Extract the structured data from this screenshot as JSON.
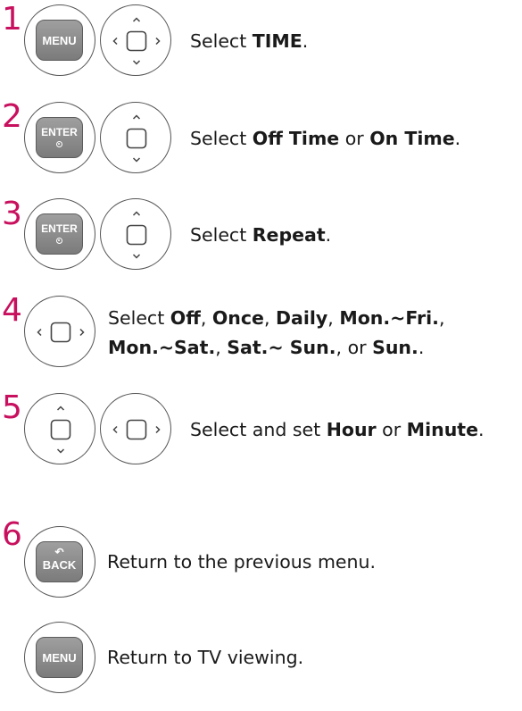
{
  "steps": [
    {
      "number": "1",
      "buttons": [
        "MENU",
        "up-down-left-right"
      ],
      "text": [
        {
          "t": "Select "
        },
        {
          "t": "TIME",
          "b": true
        },
        {
          "t": "."
        }
      ]
    },
    {
      "number": "2",
      "buttons": [
        "ENTER",
        "up-down"
      ],
      "text": [
        {
          "t": "Select "
        },
        {
          "t": "Off Time",
          "b": true
        },
        {
          "t": " or "
        },
        {
          "t": "On Time",
          "b": true
        },
        {
          "t": "."
        }
      ]
    },
    {
      "number": "3",
      "buttons": [
        "ENTER",
        "up-down"
      ],
      "text": [
        {
          "t": "Select "
        },
        {
          "t": "Repeat",
          "b": true
        },
        {
          "t": "."
        }
      ]
    },
    {
      "number": "4",
      "buttons": [
        "left-right"
      ],
      "text": [
        {
          "t": "Select "
        },
        {
          "t": "Off",
          "b": true
        },
        {
          "t": ", "
        },
        {
          "t": "Once",
          "b": true
        },
        {
          "t": ", "
        },
        {
          "t": "Daily",
          "b": true
        },
        {
          "t": ", "
        },
        {
          "t": "Mon.~Fri.",
          "b": true
        },
        {
          "t": ","
        }
      ],
      "text2": [
        {
          "t": "Mon.~Sat.",
          "b": true
        },
        {
          "t": ", "
        },
        {
          "t": "Sat.~ Sun.",
          "b": true
        },
        {
          "t": ", or "
        },
        {
          "t": "Sun.",
          "b": true
        },
        {
          "t": "."
        }
      ]
    },
    {
      "number": "5",
      "buttons": [
        "up-down",
        "left-right"
      ],
      "text": [
        {
          "t": "Select and set "
        },
        {
          "t": "Hour",
          "b": true
        },
        {
          "t": " or "
        },
        {
          "t": "Minute",
          "b": true
        },
        {
          "t": "."
        }
      ]
    },
    {
      "number": "6",
      "buttons": [
        "BACK"
      ],
      "text": [
        {
          "t": "Return to the previous menu."
        }
      ]
    },
    {
      "number": "",
      "buttons": [
        "MENU"
      ],
      "text": [
        {
          "t": "Return to TV viewing."
        }
      ]
    }
  ],
  "labels": {
    "menu": "MENU",
    "enter": "ENTER",
    "back": "BACK",
    "back_arrow": "↶"
  },
  "colors": {
    "step_number": "#c8105e",
    "button_fill": "#8c8c8c",
    "outline": "#555555"
  }
}
